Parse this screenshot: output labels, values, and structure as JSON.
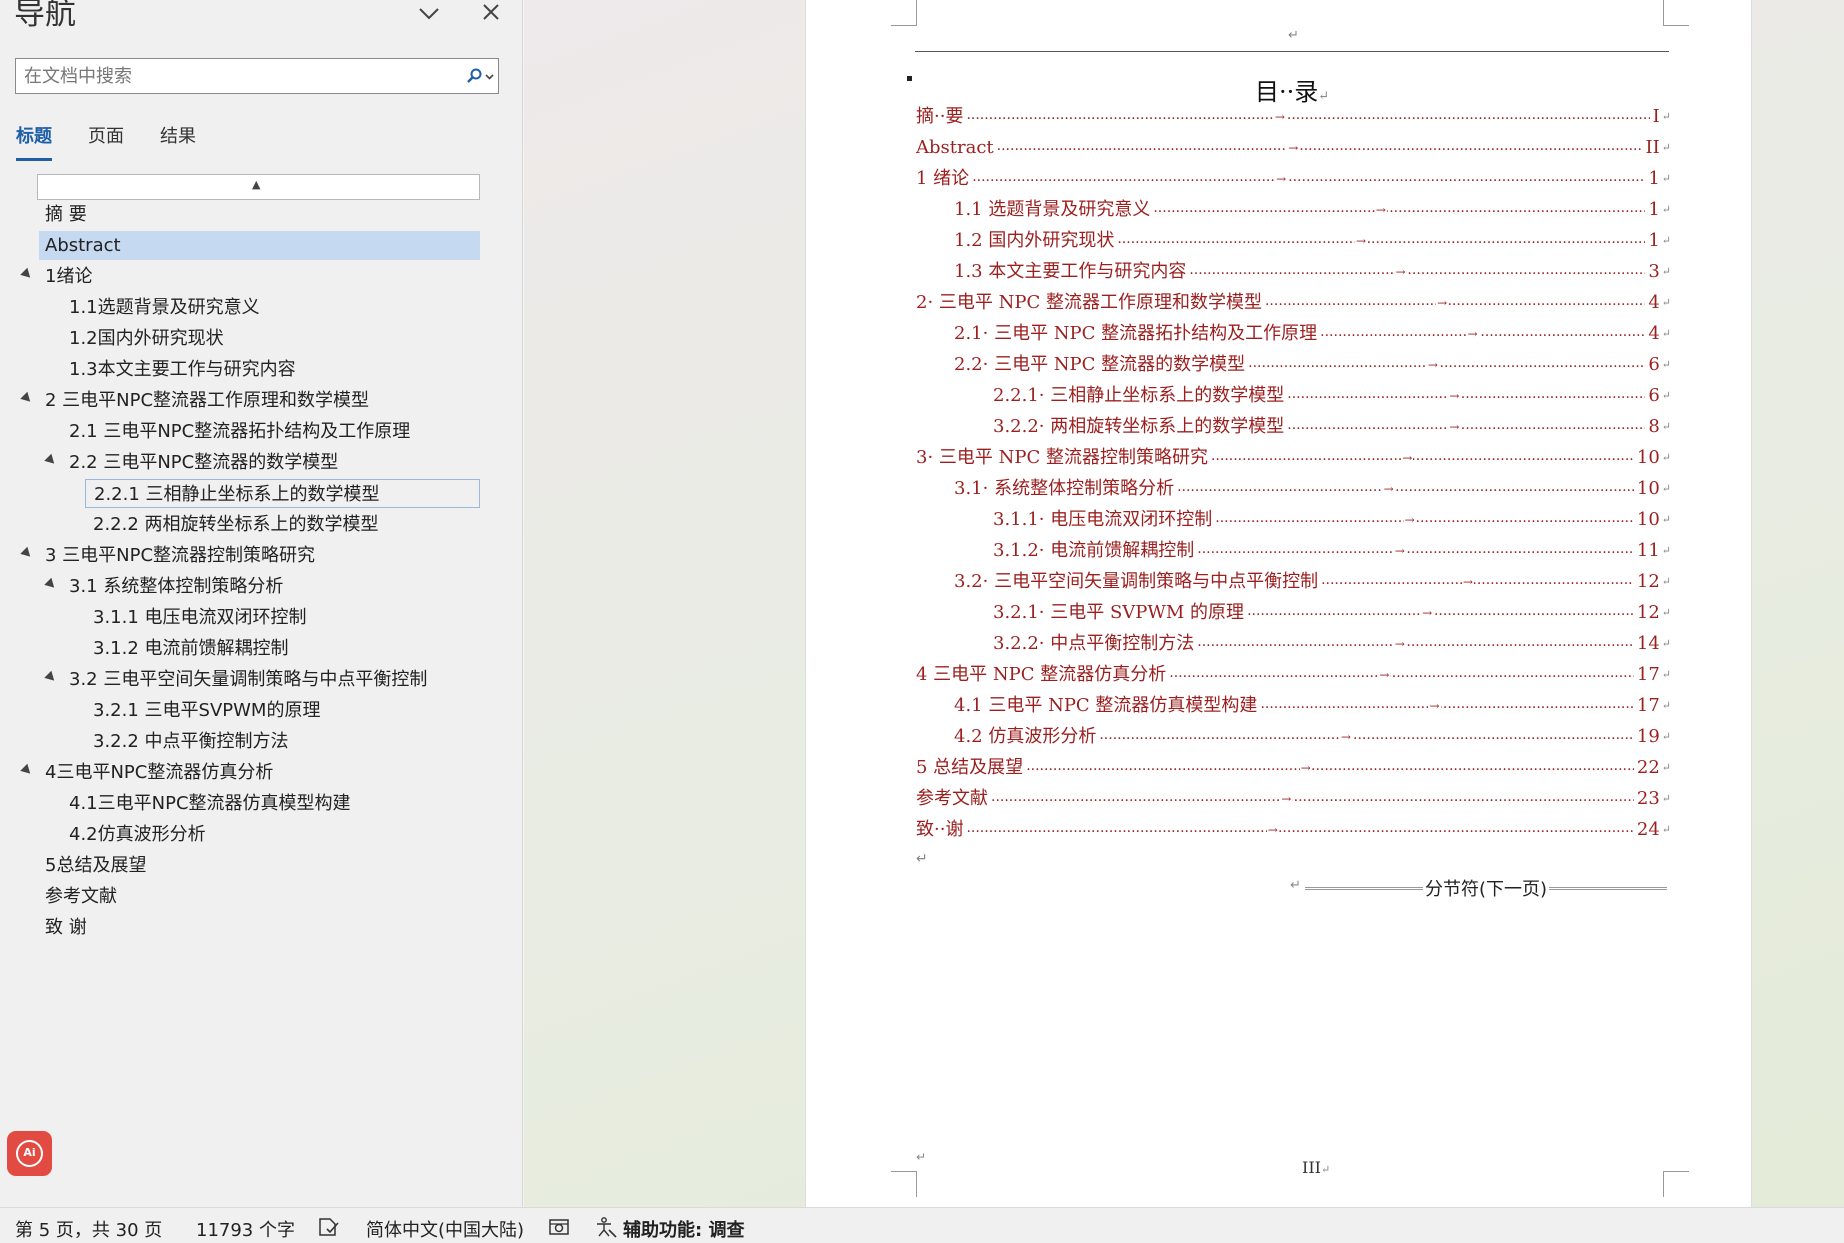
{
  "nav": {
    "title": "导航",
    "search_placeholder": "在文档中搜索",
    "tabs": [
      "标题",
      "页面",
      "结果"
    ],
    "tree": [
      {
        "label": "摘  要",
        "level": 0,
        "expanded": null,
        "selected": false
      },
      {
        "label": "Abstract",
        "level": 0,
        "expanded": null,
        "selected": true
      },
      {
        "label": "1绪论",
        "level": 0,
        "expanded": true,
        "selected": false
      },
      {
        "label": "1.1选题背景及研究意义",
        "level": 1,
        "expanded": null,
        "selected": false
      },
      {
        "label": "1.2国内外研究现状",
        "level": 1,
        "expanded": null,
        "selected": false
      },
      {
        "label": "1.3本文主要工作与研究内容",
        "level": 1,
        "expanded": null,
        "selected": false
      },
      {
        "label": "2 三电平NPC整流器工作原理和数学模型",
        "level": 0,
        "expanded": true,
        "selected": false
      },
      {
        "label": "2.1 三电平NPC整流器拓扑结构及工作原理",
        "level": 1,
        "expanded": null,
        "selected": false
      },
      {
        "label": "2.2 三电平NPC整流器的数学模型",
        "level": 1,
        "expanded": true,
        "selected": false
      },
      {
        "label": "2.2.1 三相静止坐标系上的数学模型",
        "level": 2,
        "expanded": null,
        "selected": false,
        "current": true
      },
      {
        "label": "2.2.2 两相旋转坐标系上的数学模型",
        "level": 2,
        "expanded": null,
        "selected": false
      },
      {
        "label": "3 三电平NPC整流器控制策略研究",
        "level": 0,
        "expanded": true,
        "selected": false
      },
      {
        "label": "3.1 系统整体控制策略分析",
        "level": 1,
        "expanded": true,
        "selected": false
      },
      {
        "label": "3.1.1 电压电流双闭环控制",
        "level": 2,
        "expanded": null,
        "selected": false
      },
      {
        "label": "3.1.2 电流前馈解耦控制",
        "level": 2,
        "expanded": null,
        "selected": false
      },
      {
        "label": "3.2 三电平空间矢量调制策略与中点平衡控制",
        "level": 1,
        "expanded": true,
        "selected": false
      },
      {
        "label": "3.2.1 三电平SVPWM的原理",
        "level": 2,
        "expanded": null,
        "selected": false
      },
      {
        "label": "3.2.2 中点平衡控制方法",
        "level": 2,
        "expanded": null,
        "selected": false
      },
      {
        "label": "4三电平NPC整流器仿真分析",
        "level": 0,
        "expanded": true,
        "selected": false
      },
      {
        "label": "4.1三电平NPC整流器仿真模型构建",
        "level": 1,
        "expanded": null,
        "selected": false
      },
      {
        "label": "4.2仿真波形分析",
        "level": 1,
        "expanded": null,
        "selected": false
      },
      {
        "label": "5总结及展望",
        "level": 0,
        "expanded": null,
        "selected": false
      },
      {
        "label": "参考文献",
        "level": 0,
        "expanded": null,
        "selected": false
      },
      {
        "label": "致  谢",
        "level": 0,
        "expanded": null,
        "selected": false
      }
    ]
  },
  "document": {
    "toc_title": "目··录",
    "toc": [
      {
        "text": "摘··要",
        "page": "I",
        "level": 0
      },
      {
        "text": "Abstract",
        "page": "II",
        "level": 0
      },
      {
        "text": "1 绪论",
        "page": "1",
        "level": 0
      },
      {
        "text": "1.1 选题背景及研究意义",
        "page": "1",
        "level": 1
      },
      {
        "text": "1.2 国内外研究现状",
        "page": "1",
        "level": 1
      },
      {
        "text": "1.3 本文主要工作与研究内容",
        "page": "3",
        "level": 1
      },
      {
        "text": "2· 三电平 NPC 整流器工作原理和数学模型",
        "page": "4",
        "level": 0
      },
      {
        "text": "2.1· 三电平 NPC 整流器拓扑结构及工作原理",
        "page": "4",
        "level": 1
      },
      {
        "text": "2.2· 三电平 NPC 整流器的数学模型",
        "page": "6",
        "level": 1
      },
      {
        "text": "2.2.1· 三相静止坐标系上的数学模型",
        "page": "6",
        "level": 2
      },
      {
        "text": "3.2.2· 两相旋转坐标系上的数学模型",
        "page": "8",
        "level": 2
      },
      {
        "text": "3· 三电平 NPC 整流器控制策略研究",
        "page": "10",
        "level": 0
      },
      {
        "text": "3.1· 系统整体控制策略分析",
        "page": "10",
        "level": 1
      },
      {
        "text": "3.1.1· 电压电流双闭环控制",
        "page": "10",
        "level": 2
      },
      {
        "text": "3.1.2· 电流前馈解耦控制",
        "page": "11",
        "level": 2
      },
      {
        "text": "3.2· 三电平空间矢量调制策略与中点平衡控制",
        "page": "12",
        "level": 1
      },
      {
        "text": "3.2.1· 三电平 SVPWM 的原理",
        "page": "12",
        "level": 2
      },
      {
        "text": "3.2.2· 中点平衡控制方法",
        "page": "14",
        "level": 2
      },
      {
        "text": "4 三电平 NPC 整流器仿真分析",
        "page": "17",
        "level": 0
      },
      {
        "text": "4.1 三电平 NPC 整流器仿真模型构建",
        "page": "17",
        "level": 1
      },
      {
        "text": "4.2 仿真波形分析",
        "page": "19",
        "level": 1
      },
      {
        "text": "5 总结及展望",
        "page": "22",
        "level": 0
      },
      {
        "text": "参考文献",
        "page": "23",
        "level": 0
      },
      {
        "text": "致··谢",
        "page": "24",
        "level": 0
      }
    ],
    "section_break": "分节符(下一页)",
    "page_number": "III"
  },
  "status": {
    "page": "第 5 页，共 30 页",
    "words": "11793 个字",
    "language": "简体中文(中国大陆)",
    "accessibility": "辅助功能: 调查"
  },
  "colors": {
    "toc_text": "#9c1f1f",
    "selected": "#c5d9f1",
    "accent": "#1e5fa8",
    "ai_button": "#e24b42"
  }
}
